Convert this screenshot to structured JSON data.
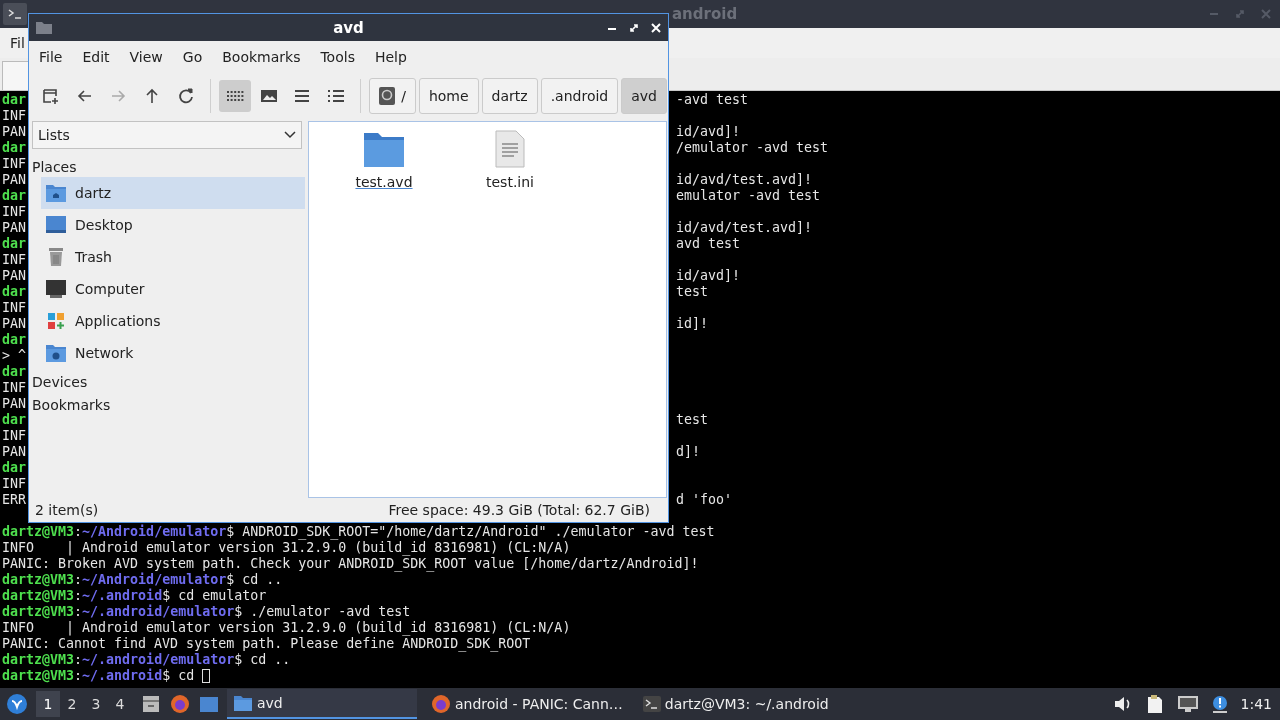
{
  "terminal": {
    "title": "android",
    "menu": [
      "Fil"
    ],
    "partial_lines": [
      {
        "kind": "prompt",
        "left": "dar",
        "right": "-avd test"
      },
      {
        "kind": "output",
        "left": "INF"
      },
      {
        "kind": "output",
        "left": "PAN",
        "right": "id/avd]!"
      },
      {
        "kind": "prompt",
        "left": "dar",
        "right": "/emulator -avd test"
      },
      {
        "kind": "output",
        "left": "INF"
      },
      {
        "kind": "output",
        "left": "PAN",
        "right": "id/avd/test.avd]!"
      },
      {
        "kind": "prompt",
        "left": "dar",
        "right": "emulator -avd test"
      },
      {
        "kind": "output",
        "left": "INF"
      },
      {
        "kind": "output",
        "left": "PAN",
        "right": "id/avd/test.avd]!"
      },
      {
        "kind": "prompt",
        "left": "dar",
        "right": "avd test"
      },
      {
        "kind": "output",
        "left": "INF"
      },
      {
        "kind": "output",
        "left": "PAN",
        "right": "id/avd]!"
      },
      {
        "kind": "prompt",
        "left": "dar",
        "right": "test"
      },
      {
        "kind": "output",
        "left": "INF"
      },
      {
        "kind": "output",
        "left": "PAN",
        "right": "id]!"
      },
      {
        "kind": "prompt",
        "left": "dar"
      },
      {
        "kind": "output",
        "left": "> ^"
      },
      {
        "kind": "prompt",
        "left": "dar"
      },
      {
        "kind": "output",
        "left": "INF"
      },
      {
        "kind": "output",
        "left": "PAN"
      },
      {
        "kind": "prompt",
        "left": "dar",
        "right": "test"
      },
      {
        "kind": "output",
        "left": "INF"
      },
      {
        "kind": "output",
        "left": "PAN",
        "right": "d]!"
      },
      {
        "kind": "prompt",
        "left": "dar"
      },
      {
        "kind": "output",
        "left": "INF"
      },
      {
        "kind": "output",
        "left": "ERR",
        "right": "d 'foo'"
      }
    ],
    "lines": [
      {
        "kind": "prompt",
        "user": "dartz@VM3",
        "sep": ":",
        "path": "~/Android/emulator",
        "command": "$ ANDROID_SDK_ROOT=\"/home/dartz/Android\" ./emulator -avd test",
        "cursor": false
      },
      {
        "kind": "output",
        "text": "INFO    | Android emulator version 31.2.9.0 (build_id 8316981) (CL:N/A)"
      },
      {
        "kind": "output",
        "text": "PANIC: Broken AVD system path. Check your ANDROID_SDK_ROOT value [/home/dartz/Android]!"
      },
      {
        "kind": "prompt",
        "user": "dartz@VM3",
        "sep": ":",
        "path": "~/Android/emulator",
        "command": "$ cd ..",
        "cursor": false
      },
      {
        "kind": "prompt",
        "user": "dartz@VM3",
        "sep": ":",
        "path": "~/.android",
        "command": "$ cd emulator",
        "cursor": false
      },
      {
        "kind": "prompt",
        "user": "dartz@VM3",
        "sep": ":",
        "path": "~/.android/emulator",
        "command": "$ ./emulator -avd test",
        "cursor": false
      },
      {
        "kind": "output",
        "text": "INFO    | Android emulator version 31.2.9.0 (build_id 8316981) (CL:N/A)"
      },
      {
        "kind": "output",
        "text": "PANIC: Cannot find AVD system path. Please define ANDROID_SDK_ROOT"
      },
      {
        "kind": "prompt",
        "user": "dartz@VM3",
        "sep": ":",
        "path": "~/.android/emulator",
        "command": "$ cd ..",
        "cursor": false
      },
      {
        "kind": "prompt",
        "user": "dartz@VM3",
        "sep": ":",
        "path": "~/.android",
        "command": "$ cd",
        "cursor": true
      }
    ]
  },
  "file_manager": {
    "title": "avd",
    "menu": [
      "File",
      "Edit",
      "View",
      "Go",
      "Bookmarks",
      "Tools",
      "Help"
    ],
    "nav_buttons": [
      {
        "kind": "new-window",
        "disabled": false
      },
      {
        "kind": "back",
        "disabled": false
      },
      {
        "kind": "forward",
        "disabled": true
      },
      {
        "kind": "up",
        "disabled": false
      },
      {
        "kind": "reload",
        "disabled": false
      }
    ],
    "view_modes": [
      {
        "kind": "icons",
        "selected": true
      },
      {
        "kind": "thumbnails",
        "selected": false
      },
      {
        "kind": "compact",
        "selected": false
      },
      {
        "kind": "detailed",
        "selected": false
      }
    ],
    "path": [
      {
        "label": "/",
        "kind": "root",
        "selected": false
      },
      {
        "label": "home",
        "kind": "folder",
        "selected": false
      },
      {
        "label": "dartz",
        "kind": "folder",
        "selected": false
      },
      {
        "label": ".android",
        "kind": "folder",
        "selected": false
      },
      {
        "label": "avd",
        "kind": "folder",
        "selected": true
      }
    ],
    "side_mode": "Lists",
    "places_header": "Places",
    "places": [
      {
        "label": "dartz",
        "kind": "home",
        "selected": true
      },
      {
        "label": "Desktop",
        "kind": "desktop",
        "selected": false
      },
      {
        "label": "Trash",
        "kind": "trash",
        "selected": false
      },
      {
        "label": "Computer",
        "kind": "computer",
        "selected": false
      },
      {
        "label": "Applications",
        "kind": "applications",
        "selected": false
      },
      {
        "label": "Network",
        "kind": "network",
        "selected": false
      }
    ],
    "sections": [
      "Devices",
      "Bookmarks"
    ],
    "files": [
      {
        "name": "test.avd",
        "kind": "folder",
        "focused": true
      },
      {
        "name": "test.ini",
        "kind": "text",
        "focused": false
      }
    ],
    "status_left": "2 item(s)",
    "status_right": "Free space: 49.3 GiB (Total: 62.7 GiB)"
  },
  "taskbar": {
    "workspaces": [
      {
        "label": "1",
        "selected": true
      },
      {
        "label": "2",
        "selected": false
      },
      {
        "label": "3",
        "selected": false
      },
      {
        "label": "4",
        "selected": false
      }
    ],
    "tasks": [
      {
        "label": "avd",
        "kind": "folder",
        "selected": true
      },
      {
        "label": "android - PANIC: Cann…",
        "kind": "browser",
        "selected": false
      },
      {
        "label": "dartz@VM3: ~/.android",
        "kind": "terminal",
        "selected": false
      }
    ],
    "clock": "1:41"
  }
}
